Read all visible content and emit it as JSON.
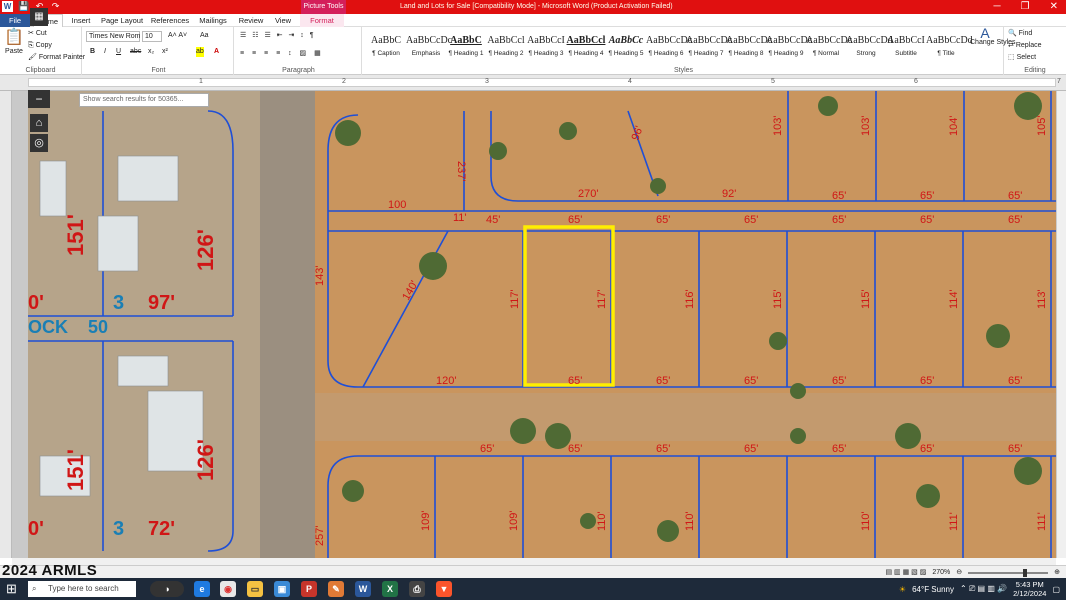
{
  "titlebar": {
    "doc_title": "Land and Lots for Sale [Compatibility Mode] - Microsoft Word (Product Activation Failed)",
    "context_tab_group": "Picture Tools",
    "word_icon": "W",
    "undo_icon": "↶",
    "redo_icon": "↷",
    "save_icon": "💾",
    "minimize": "─",
    "restore": "❐",
    "close": "✕"
  },
  "tabs": {
    "file": "File",
    "home": "Home",
    "insert": "Insert",
    "page_layout": "Page Layout",
    "references": "References",
    "mailings": "Mailings",
    "review": "Review",
    "view": "View",
    "format": "Format"
  },
  "ribbon": {
    "clipboard": {
      "label": "Clipboard",
      "paste": "Paste",
      "cut": "Cut",
      "copy": "Copy",
      "format_painter": "Format Painter"
    },
    "font": {
      "label": "Font",
      "font_name": "Times New Rom",
      "font_size": "10",
      "bold": "B",
      "italic": "I",
      "underline": "U",
      "strike": "abc",
      "sub": "x₂",
      "sup": "x²"
    },
    "paragraph": {
      "label": "Paragraph"
    },
    "styles": {
      "label": "Styles",
      "items": [
        {
          "sample": "AaBbC",
          "name": "¶ Caption"
        },
        {
          "sample": "AaBbCcDc",
          "name": "Emphasis"
        },
        {
          "sample": "AaBbC",
          "name": "¶ Heading 1"
        },
        {
          "sample": "AaBbCcl",
          "name": "¶ Heading 2"
        },
        {
          "sample": "AaBbCcI",
          "name": "¶ Heading 3"
        },
        {
          "sample": "AaBbCcl",
          "name": "¶ Heading 4"
        },
        {
          "sample": "AaBbCc",
          "name": "¶ Heading 5"
        },
        {
          "sample": "AaBbCcDc",
          "name": "¶ Heading 6"
        },
        {
          "sample": "AaBbCcDc",
          "name": "¶ Heading 7"
        },
        {
          "sample": "AaBbCcDc",
          "name": "¶ Heading 8"
        },
        {
          "sample": "AaBbCcDc",
          "name": "¶ Heading 9"
        },
        {
          "sample": "AaBbCcDc",
          "name": "¶ Normal"
        },
        {
          "sample": "AaBbCcDd",
          "name": "Strong"
        },
        {
          "sample": "AaBbCcI",
          "name": "Subtitle"
        },
        {
          "sample": "AaBbCcDd",
          "name": "¶ Title"
        }
      ],
      "change_styles": "Change Styles"
    },
    "editing": {
      "label": "Editing",
      "find": "Find",
      "replace": "Replace",
      "select": "Select"
    }
  },
  "ruler_numbers": [
    "1",
    "2",
    "3",
    "4",
    "5",
    "6",
    "7"
  ],
  "map": {
    "search_placeholder": "Show search results for 50365...",
    "minus": "−",
    "home_icon": "⌂",
    "locate_icon": "◎",
    "grid_icon": "▦",
    "dims": [
      "237'",
      "100",
      "11'",
      "143'",
      "140'",
      "120'",
      "45'",
      "65'",
      "65'",
      "65'",
      "65'",
      "65'",
      "65'",
      "270'",
      "92'",
      "65'",
      "65'",
      "65'",
      "117'",
      "117'",
      "116'",
      "115'",
      "115'",
      "114'",
      "113'",
      "65'",
      "65'",
      "65'",
      "65'",
      "65'",
      "65'",
      "65'",
      "65'",
      "65'",
      "65'",
      "65'",
      "65'",
      "65'",
      "109'",
      "109'",
      "110'",
      "110'",
      "110'",
      "111'",
      "111'",
      "257'",
      "103'",
      "103'",
      "104'",
      "105'",
      "96'"
    ],
    "big_labels": [
      "151'",
      "126'",
      "97'",
      "3",
      "OCK",
      "50",
      "0'",
      "151'",
      "126'",
      "3",
      "72'",
      "0'"
    ]
  },
  "colors": {
    "title_red": "#e01010",
    "picture_tools": "#d41f5a",
    "word_blue": "#2b579a",
    "parcel_line": "#1f4fd6",
    "dim_red": "#d01616",
    "highlight": "#ffee00",
    "ground": "#c9955e"
  },
  "statusbar": {
    "zoom": "270%",
    "watermark": "2024 ARMLS"
  },
  "taskbar": {
    "search": "Type here to search",
    "weather": "64°F Sunny",
    "time": "5:43 PM",
    "date": "2/12/2024"
  }
}
